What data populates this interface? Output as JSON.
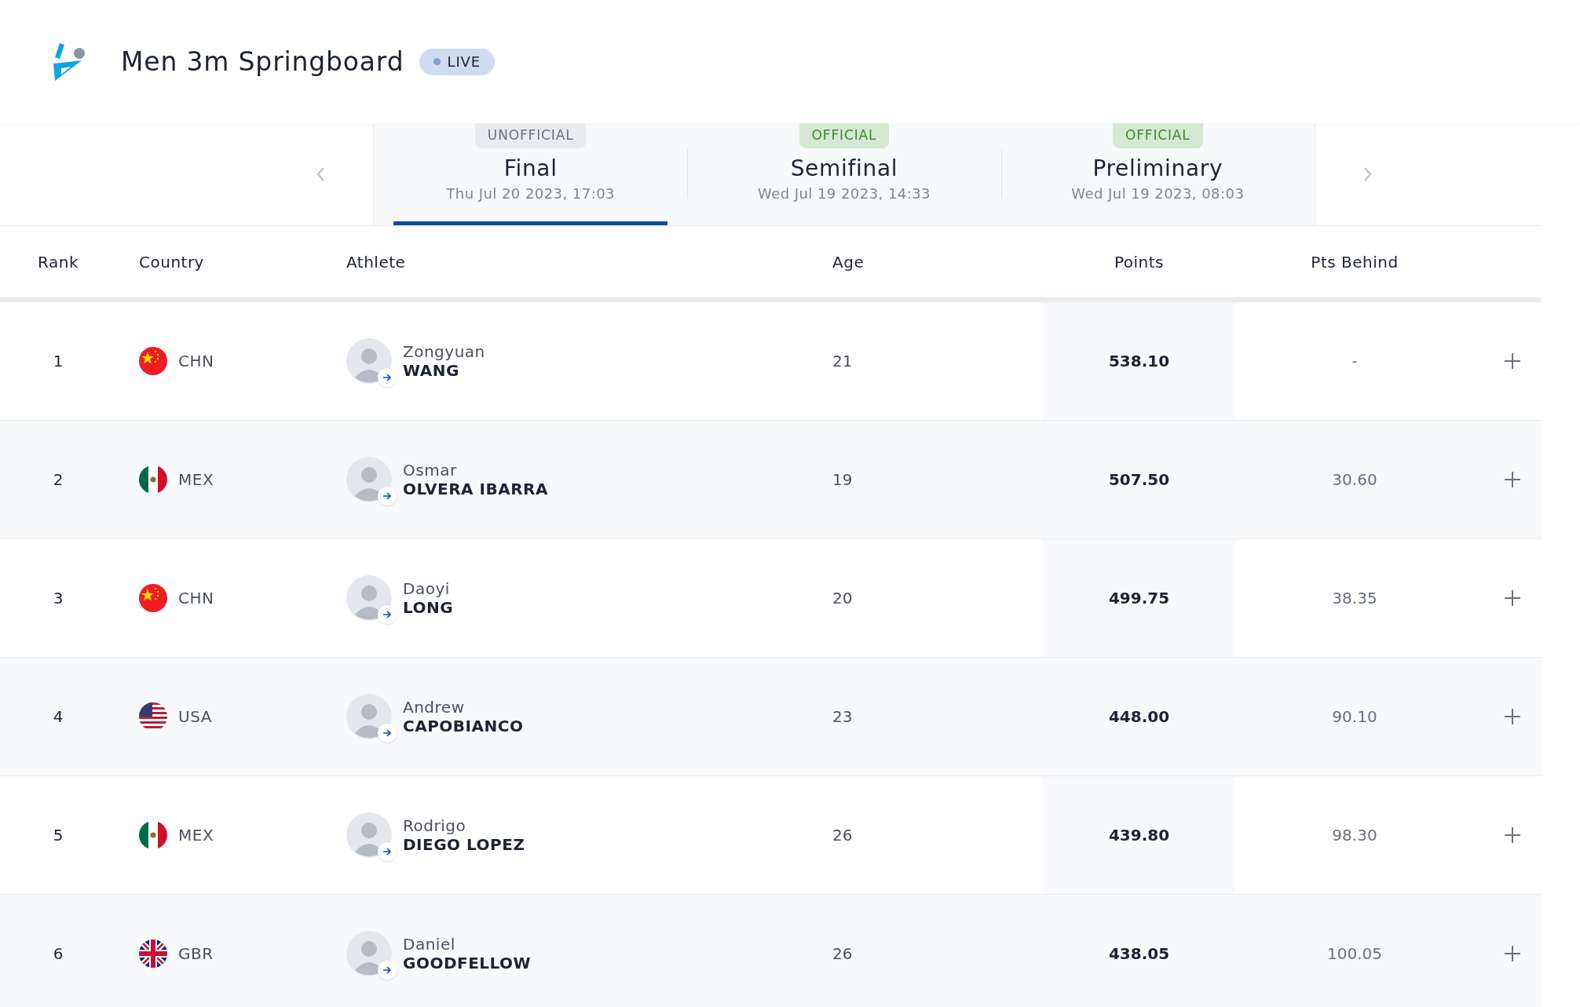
{
  "header": {
    "title": "Men 3m Springboard",
    "badge": "LIVE"
  },
  "phases": [
    {
      "status": "UNOFFICIAL",
      "official": false,
      "name": "Final",
      "date": "Thu Jul 20 2023, 17:03",
      "selected": true
    },
    {
      "status": "OFFICIAL",
      "official": true,
      "name": "Semifinal",
      "date": "Wed Jul 19 2023, 14:33",
      "selected": false
    },
    {
      "status": "OFFICIAL",
      "official": true,
      "name": "Preliminary",
      "date": "Wed Jul 19 2023, 08:03",
      "selected": false
    }
  ],
  "table": {
    "columns": [
      "Rank",
      "Country",
      "Athlete",
      "Age",
      "Points",
      "Pts Behind"
    ],
    "rows": [
      {
        "rank": "1",
        "kind": "cn",
        "country": "CHN",
        "first": "Zongyuan",
        "last": "WANG",
        "age": "21",
        "points": "538.10",
        "behind": "-"
      },
      {
        "rank": "2",
        "kind": "mx",
        "country": "MEX",
        "first": "Osmar",
        "last": "OLVERA IBARRA",
        "age": "19",
        "points": "507.50",
        "behind": "30.60"
      },
      {
        "rank": "3",
        "kind": "cn",
        "country": "CHN",
        "first": "Daoyi",
        "last": "LONG",
        "age": "20",
        "points": "499.75",
        "behind": "38.35"
      },
      {
        "rank": "4",
        "kind": "us",
        "country": "USA",
        "first": "Andrew",
        "last": "CAPOBIANCO",
        "age": "23",
        "points": "448.00",
        "behind": "90.10"
      },
      {
        "rank": "5",
        "kind": "mx",
        "country": "MEX",
        "first": "Rodrigo",
        "last": "DIEGO LOPEZ",
        "age": "26",
        "points": "439.80",
        "behind": "98.30"
      },
      {
        "rank": "6",
        "kind": "gb",
        "country": "GBR",
        "first": "Daniel",
        "last": "GOODFELLOW",
        "age": "26",
        "points": "438.05",
        "behind": "100.05"
      }
    ]
  }
}
